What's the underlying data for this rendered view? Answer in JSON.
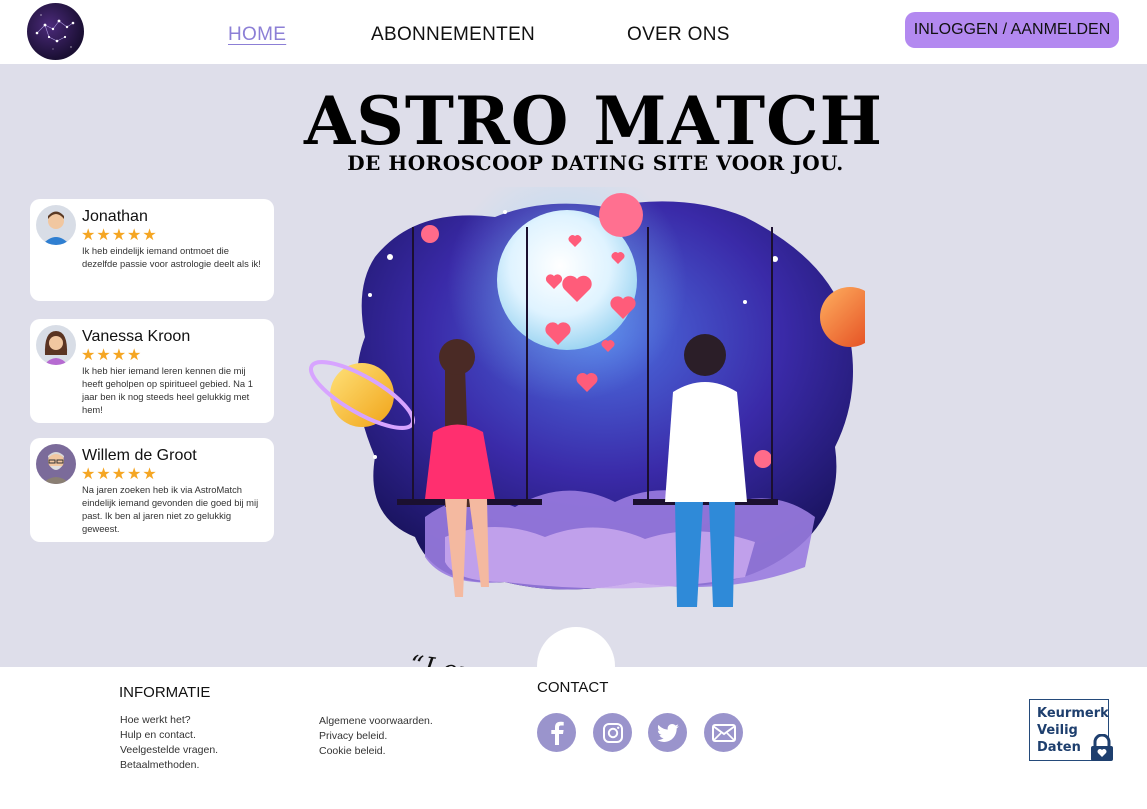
{
  "header": {
    "logo_icon": "constellation-logo-icon",
    "nav": [
      {
        "label": "HOME",
        "active": true
      },
      {
        "label": "ABONNEMENTEN",
        "active": false
      },
      {
        "label": "OVER ONS",
        "active": false
      }
    ],
    "login_label": "INLOGGEN / AANMELDEN",
    "accent_color": "#b389f0"
  },
  "hero": {
    "title": "ASTRO MATCH",
    "subtitle": "DE HOROSCOOP DATING SITE VOOR JOU.",
    "quote": "“Love is where the stars align ”",
    "illustration_icon": "couple-on-swings-under-moon-illustration"
  },
  "reviews": [
    {
      "name": "Jonathan",
      "rating": 5,
      "stars": "★★★★★",
      "text": "Ik heb eindelijk iemand ontmoet die dezelfde passie voor astrologie deelt als ik!"
    },
    {
      "name": "Vanessa Kroon",
      "rating": 4,
      "stars": "★★★★",
      "text": "Ik heb hier iemand leren kennen die mij heeft geholpen op spiritueel gebied. Na 1 jaar ben ik nog steeds heel gelukkig met hem!"
    },
    {
      "name": "Willem de Groot",
      "rating": 5,
      "stars": "★★★★★",
      "text": "Na jaren zoeken heb ik via AstroMatch eindelijk iemand gevonden die goed bij mij past. Ik ben al jaren niet zo gelukkig geweest."
    }
  ],
  "footer": {
    "info_heading": "INFORMATIE",
    "info_links": [
      "Hoe werkt het?",
      "Hulp en contact.",
      "Veelgestelde vragen.",
      "Betaalmethoden."
    ],
    "legal_links": [
      "Algemene voorwaarden.",
      "Privacy beleid.",
      "Cookie beleid."
    ],
    "contact_heading": "CONTACT",
    "social_icons": [
      "facebook-icon",
      "instagram-icon",
      "twitter-icon",
      "mail-icon"
    ],
    "social_color": "#9a94cc",
    "badge_lines": [
      "Keurmerk",
      "Veilig",
      "Daten"
    ]
  }
}
